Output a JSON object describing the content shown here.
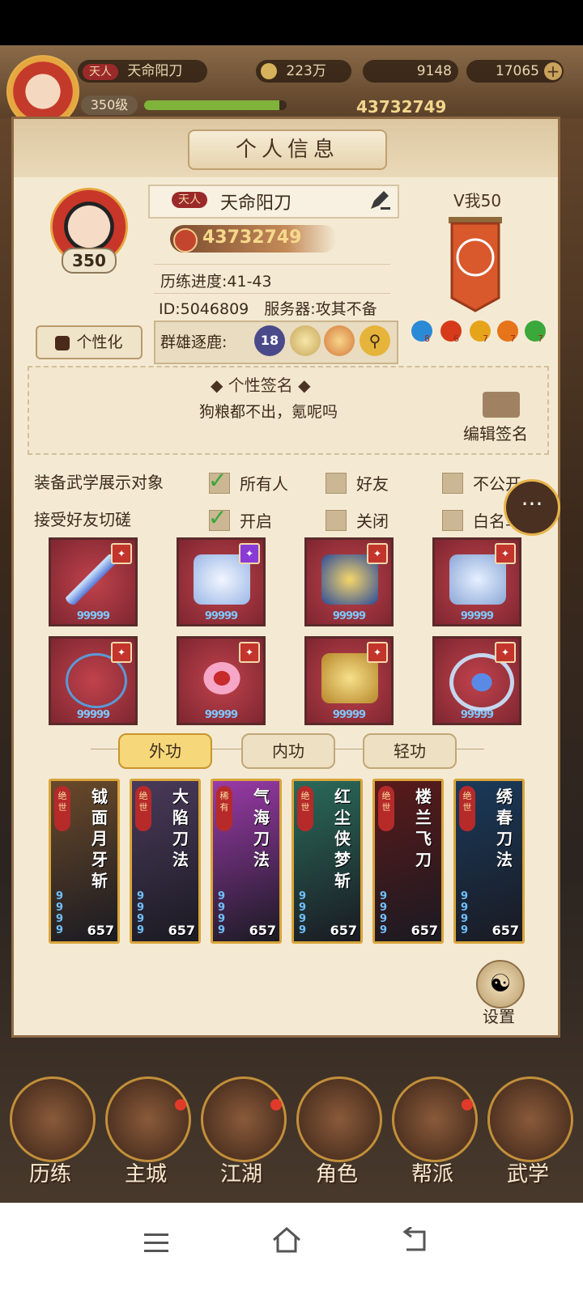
{
  "topbar": {
    "title_tag": "天人",
    "player_name": "天命阳刀",
    "silver": "223万",
    "ingots": "9148",
    "gold": "17065",
    "level": "350级",
    "exp_fraction": 0.95,
    "power": "43732749"
  },
  "panel": {
    "title": "个人信息"
  },
  "profile": {
    "level": "350",
    "title_tag": "天人",
    "name": "天命阳刀",
    "power": "43732749",
    "progress": "历练进度:41-43",
    "id_server": "ID:5046809　服务器:攻其不备",
    "vip": "V我50",
    "gems": [
      "8",
      "6",
      "7",
      "7",
      "7"
    ],
    "customize": "个性化",
    "hero_label": "群雄逐鹿:",
    "hero_rank": "18"
  },
  "signature": {
    "title": "个性签名",
    "text": "狗粮都不出，氪呢吗",
    "edit": "编辑签名"
  },
  "options": {
    "row1_label": "装备武学展示对象",
    "row1": [
      "所有人",
      "好友",
      "不公开"
    ],
    "row2_label": "接受好友切磋",
    "row2": [
      "开启",
      "关闭",
      "白名单"
    ]
  },
  "equipment": {
    "level_text": "99999"
  },
  "tabs": [
    "外功",
    "内功",
    "轻功"
  ],
  "skills": [
    {
      "name": "钺面月牙斩",
      "rank": "绝世",
      "value": "657",
      "color": "#6a4a2a"
    },
    {
      "name": "大陷刀法",
      "rank": "绝世",
      "value": "657",
      "color": "#4a3a5a"
    },
    {
      "name": "气海刀法",
      "rank": "稀有",
      "value": "657",
      "color": "#9a3aa8"
    },
    {
      "name": "红尘侠梦斩",
      "rank": "绝世",
      "value": "657",
      "color": "#2a6a5a"
    },
    {
      "name": "楼兰飞刀",
      "rank": "绝世",
      "value": "657",
      "color": "#5a1a1a"
    },
    {
      "name": "绣春刀法",
      "rank": "绝世",
      "value": "657",
      "color": "#1a3a5a"
    }
  ],
  "settings": "设置",
  "nav": [
    "历练",
    "主城",
    "江湖",
    "角色",
    "帮派",
    "武学"
  ]
}
